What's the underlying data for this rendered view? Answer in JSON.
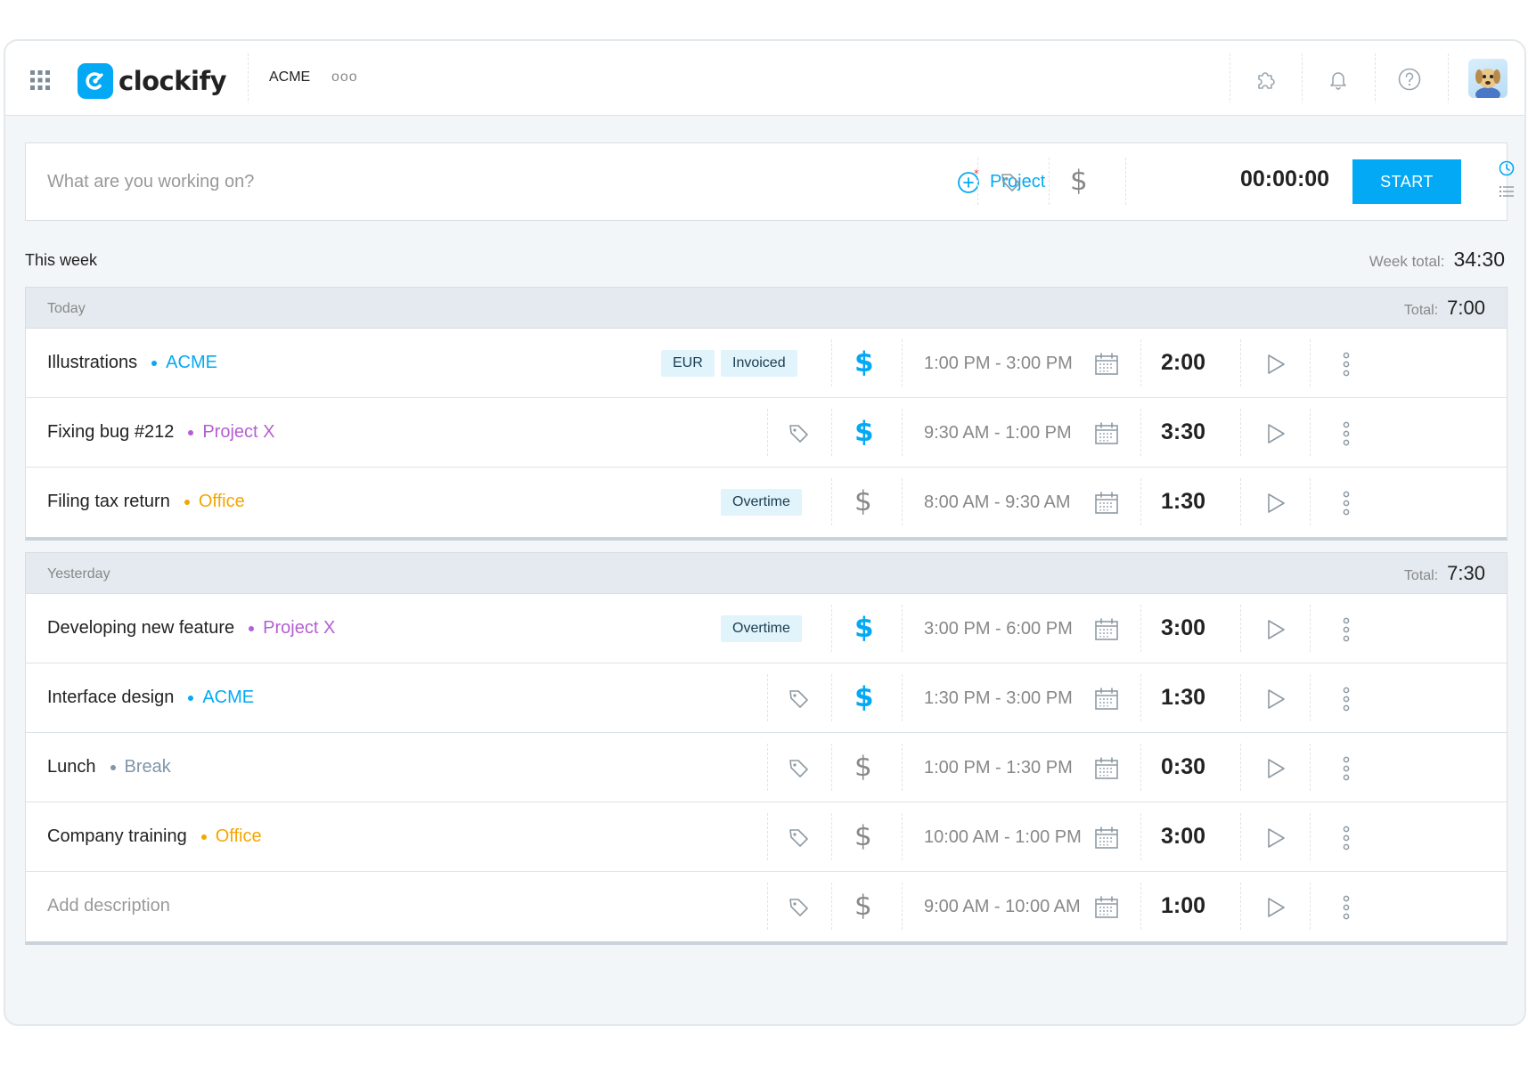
{
  "app": {
    "logo_text": "clockify",
    "workspace": "ACME",
    "more_label": "ooo",
    "accent_color": "#03a9f4"
  },
  "header_icons": [
    "apps-grid-icon",
    "puzzle-icon",
    "bell-icon",
    "help-icon",
    "avatar"
  ],
  "timer": {
    "placeholder": "What are you working on?",
    "project_label": "Project",
    "time": "00:00:00",
    "start_label": "START"
  },
  "week": {
    "title": "This week",
    "total_label": "Week total:",
    "total": "34:30"
  },
  "groups": [
    {
      "day": "Today",
      "total_label": "Total:",
      "total": "7:00",
      "entries": [
        {
          "description": "Illustrations",
          "project": "ACME",
          "project_color": "#03a9f4",
          "badges": [
            "EUR",
            "Invoiced"
          ],
          "billable": true,
          "range": "1:00 PM - 3:00 PM",
          "duration": "2:00"
        },
        {
          "description": "Fixing bug #212",
          "project": "Project X",
          "project_color": "#b45fd2",
          "badges": [],
          "billable": true,
          "range": "9:30 AM - 1:00 PM",
          "duration": "3:30"
        },
        {
          "description": "Filing tax return",
          "project": "Office",
          "project_color": "#f4a600",
          "badges": [
            "Overtime"
          ],
          "billable": false,
          "range": "8:00 AM - 9:30 AM",
          "duration": "1:30"
        }
      ]
    },
    {
      "day": "Yesterday",
      "total_label": "Total:",
      "total": "7:30",
      "entries": [
        {
          "description": "Developing new feature",
          "project": "Project X",
          "project_color": "#b45fd2",
          "badges": [
            "Overtime"
          ],
          "billable": true,
          "range": "3:00 PM - 6:00 PM",
          "duration": "3:00"
        },
        {
          "description": "Interface design",
          "project": "ACME",
          "project_color": "#03a9f4",
          "badges": [],
          "billable": true,
          "range": "1:30 PM - 3:00 PM",
          "duration": "1:30"
        },
        {
          "description": "Lunch",
          "project": "Break",
          "project_color": "#7f95a8",
          "badges": [],
          "billable": false,
          "range": "1:00 PM - 1:30 PM",
          "duration": "0:30"
        },
        {
          "description": "Company training",
          "project": "Office",
          "project_color": "#f4a600",
          "badges": [],
          "billable": false,
          "range": "10:00 AM - 1:00 PM",
          "duration": "3:00"
        },
        {
          "description": "",
          "placeholder": "Add description",
          "project": "",
          "project_color": "",
          "badges": [],
          "billable": false,
          "range": "9:00 AM - 10:00 AM",
          "duration": "1:00"
        }
      ]
    }
  ]
}
